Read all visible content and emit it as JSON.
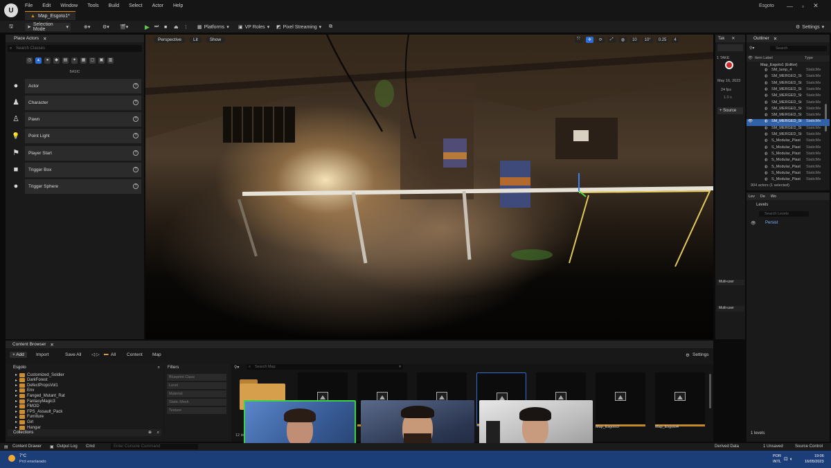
{
  "window": {
    "logo": "U",
    "menu": [
      "File",
      "Edit",
      "Window",
      "Tools",
      "Build",
      "Select",
      "Actor",
      "Help"
    ],
    "map_tab": "Map_Esgoto1*",
    "project_name": "Esgoto",
    "controls": [
      "—",
      "▫",
      "✕"
    ]
  },
  "toolbar": {
    "save_icon": "save-icon",
    "selection_mode": "Selection Mode",
    "platforms": "Platforms",
    "vp_roles": "VP Roles",
    "pixel_streaming": "Pixel Streaming",
    "settings": "Settings"
  },
  "place_actors": {
    "title": "Place Actors",
    "search_placeholder": "Search Classes",
    "category": "BASIC",
    "items": [
      {
        "label": "Actor",
        "icon": "●"
      },
      {
        "label": "Character",
        "icon": "♟"
      },
      {
        "label": "Pawn",
        "icon": "♙"
      },
      {
        "label": "Point Light",
        "icon": "💡"
      },
      {
        "label": "Player Start",
        "icon": "⚑"
      },
      {
        "label": "Trigger Box",
        "icon": "■"
      },
      {
        "label": "Trigger Sphere",
        "icon": "●"
      }
    ]
  },
  "viewport": {
    "perspective": "Perspective",
    "lit": "Lit",
    "show": "Show",
    "snap_values": [
      "10",
      "10°",
      "0.25",
      "4"
    ]
  },
  "take_recorder": {
    "tab": "Tak",
    "take": "1 TAKE",
    "date": "May 16, 2023",
    "fps": "24 fps",
    "multiplier": "1.0 x",
    "source": "+ Source",
    "multi_user_1": "Multi-user",
    "multi_user_2": "Multi-user"
  },
  "outliner": {
    "title": "Outliner",
    "search_placeholder": "Search",
    "col_label": "Item Label",
    "col_type": "Type",
    "root": "Map_Esgoto1 (Editor)",
    "rows": [
      {
        "label": "SM_lamp_4",
        "type": "StaticMe"
      },
      {
        "label": "SM_MERGED_St",
        "type": "StaticMe"
      },
      {
        "label": "SM_MERGED_St",
        "type": "StaticMe"
      },
      {
        "label": "SM_MERGED_St",
        "type": "StaticMe"
      },
      {
        "label": "SM_MERGED_St",
        "type": "StaticMe"
      },
      {
        "label": "SM_MERGED_St",
        "type": "StaticMe"
      },
      {
        "label": "SM_MERGED_St",
        "type": "StaticMe"
      },
      {
        "label": "SM_MERGED_St",
        "type": "StaticMe"
      },
      {
        "label": "SM_MERGED_St",
        "type": "StaticMe",
        "selected": true
      },
      {
        "label": "SM_MERGED_St",
        "type": "StaticMe"
      },
      {
        "label": "SM_MERGED_St",
        "type": "StaticMe"
      },
      {
        "label": "S_Modular_Plast",
        "type": "StaticMe"
      },
      {
        "label": "S_Modular_Plast",
        "type": "StaticMe"
      },
      {
        "label": "S_Modular_Plast",
        "type": "StaticMe"
      },
      {
        "label": "S_Modular_Plast",
        "type": "StaticMe"
      },
      {
        "label": "S_Modular_Plast",
        "type": "StaticMe"
      },
      {
        "label": "S_Modular_Plast",
        "type": "StaticMe"
      },
      {
        "label": "S_Modular_Plast",
        "type": "StaticMe"
      }
    ],
    "count": "904 actors (1 selected)"
  },
  "levels": {
    "tabs": [
      "Lev",
      "De",
      "Wo"
    ],
    "title": "Levels",
    "search_placeholder": "Search Levels",
    "persistent": "Persist",
    "count": "1 levels"
  },
  "content_browser": {
    "title": "Content Browser",
    "add": "+ Add",
    "import": "Import",
    "save_all": "Save All",
    "breadcrumb": [
      "All",
      "Content",
      "Map"
    ],
    "settings": "Settings",
    "root": "Esgoto",
    "tree": [
      "Customized_Soldier",
      "DarkForest",
      "DefectPropsVol1",
      "Env",
      "Fanged_Mutant_Rat",
      "FantasyMagic3",
      "FMOD",
      "FPS_Assault_Pack",
      "Furniture",
      "Girl",
      "Hangar"
    ],
    "collections": "Collections",
    "filters_title": "Filters",
    "filters": [
      "Blueprint Class",
      "Level",
      "Material",
      "Static Mesh",
      "Texture"
    ],
    "search_placeholder": "Search Map",
    "item_count": "12 item",
    "asset_labels": [
      "Map_Esgoto3",
      "Map_Esgoto4"
    ]
  },
  "statusbar": {
    "content_drawer": "Content Drawer",
    "output_log": "Output Log",
    "cmd": "Cmd",
    "cmd_placeholder": "Enter Console Command",
    "derived_data": "Derived Data",
    "unsaved": "1 Unsaved",
    "source_control": "Source Control"
  },
  "taskbar": {
    "weather_temp": "7°C",
    "weather_desc": "Prct ensolarado",
    "lang": "POR",
    "lang2": "INTL",
    "time": "19:06",
    "date": "16/05/2023"
  }
}
